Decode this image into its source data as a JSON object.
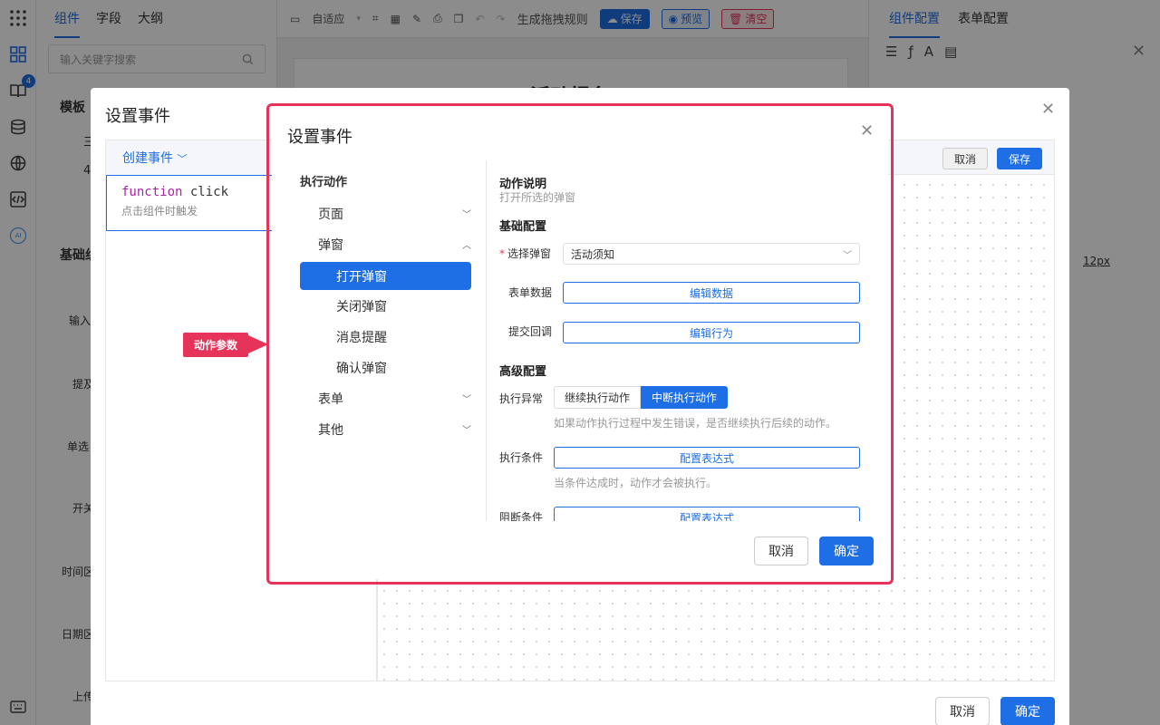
{
  "app": {
    "left_tabs": [
      "组件",
      "字段",
      "大纲"
    ],
    "search_placeholder": "输入关键字搜索",
    "rail_badge": "4",
    "rail_ai": "AI",
    "toolbar": {
      "fit": "自适应",
      "gen_rule": "生成拖拽规则",
      "save": "保存",
      "preview": "预览",
      "clear": "清空"
    },
    "right_tabs": [
      "组件配置",
      "表单配置"
    ],
    "right_value": "12px",
    "right_badge": "!",
    "bottom_cancel": "取消",
    "bottom_ok": "确定",
    "bg_section_1": "模板",
    "bg_section_2": "基础组",
    "bg_items": [
      "输入",
      "提及",
      "单选",
      "开关",
      "时间区",
      "日期区",
      "上传"
    ],
    "bg_table": [
      "三",
      "4"
    ],
    "canvas_title": "活动报名"
  },
  "outer_dialog": {
    "title": "设置事件",
    "create_event": "创建事件",
    "event_fn_kw": "function",
    "event_fn_name": "click",
    "event_desc": "点击组件时触发",
    "cancel": "取消",
    "save": "保存"
  },
  "annotation": {
    "label": "动作参数"
  },
  "inner_dialog": {
    "title": "设置事件",
    "tree_head": "执行动作",
    "tree": {
      "page": "页面",
      "popup": "弹窗",
      "open_popup": "打开弹窗",
      "close_popup": "关闭弹窗",
      "message": "消息提醒",
      "confirm_popup": "确认弹窗",
      "form": "表单",
      "other": "其他"
    },
    "desc_title": "动作说明",
    "desc_text": "打开所选的弹窗",
    "basic_title": "基础配置",
    "select_label": "选择弹窗",
    "select_value": "活动须知",
    "form_data_label": "表单数据",
    "form_data_btn": "编辑数据",
    "callback_label": "提交回调",
    "callback_btn": "编辑行为",
    "advanced_title": "高级配置",
    "error_label": "执行异常",
    "error_opts": [
      "继续执行动作",
      "中断执行动作"
    ],
    "error_hint": "如果动作执行过程中发生错误，是否继续执行后续的动作。",
    "cond_label": "执行条件",
    "cond_btn": "配置表达式",
    "cond_hint": "当条件达成时，动作才会被执行。",
    "block_label": "阻断条件",
    "block_btn": "配置表达式",
    "cancel": "取消",
    "ok": "确定"
  }
}
